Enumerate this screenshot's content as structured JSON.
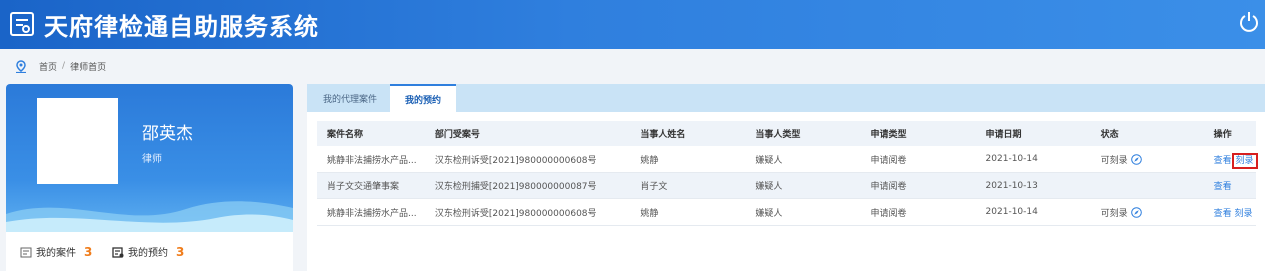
{
  "header": {
    "title": "天府律检通自助服务系统"
  },
  "breadcrumb": {
    "home": "首页",
    "separator": "/",
    "current": "律师首页"
  },
  "profile": {
    "name": "邵英杰",
    "role": "律师",
    "cases_label": "我的案件",
    "cases_count": "3",
    "appointments_label": "我的预约",
    "appointments_count": "3"
  },
  "tabs": [
    {
      "label": "我的代理案件",
      "active": false
    },
    {
      "label": "我的预约",
      "active": true
    }
  ],
  "table": {
    "columns": [
      "案件名称",
      "部门受案号",
      "当事人姓名",
      "当事人类型",
      "申请类型",
      "申请日期",
      "状态",
      "操作"
    ],
    "rows": [
      {
        "case_name": "姚静非法捕捞水产品...",
        "dept_no": "汉东检刑诉受[2021]980000000608号",
        "party_name": "姚静",
        "party_type": "嫌疑人",
        "apply_type": "申请阅卷",
        "apply_date": "2021-10-14",
        "status": "可刻录",
        "view": "查看",
        "burn": "刻录"
      },
      {
        "case_name": "肖子文交通肇事案",
        "dept_no": "汉东检刑捕受[2021]980000000087号",
        "party_name": "肖子文",
        "party_type": "嫌疑人",
        "apply_type": "申请阅卷",
        "apply_date": "2021-10-13",
        "status": "",
        "view": "查看",
        "burn": ""
      },
      {
        "case_name": "姚静非法捕捞水产品...",
        "dept_no": "汉东检刑诉受[2021]980000000608号",
        "party_name": "姚静",
        "party_type": "嫌疑人",
        "apply_type": "申请阅卷",
        "apply_date": "2021-10-14",
        "status": "可刻录",
        "view": "查看",
        "burn": "刻录"
      }
    ]
  },
  "icons": {
    "logo": "document-list-icon",
    "power": "power-icon",
    "home": "location-pin-icon",
    "cases": "folder-icon",
    "appointments": "calendar-list-icon",
    "status": "compass-icon"
  },
  "colors": {
    "header": "#2f7fde",
    "accent_count": "#f07d1c",
    "link": "#2f7fde",
    "highlight": "#d71f1f"
  }
}
